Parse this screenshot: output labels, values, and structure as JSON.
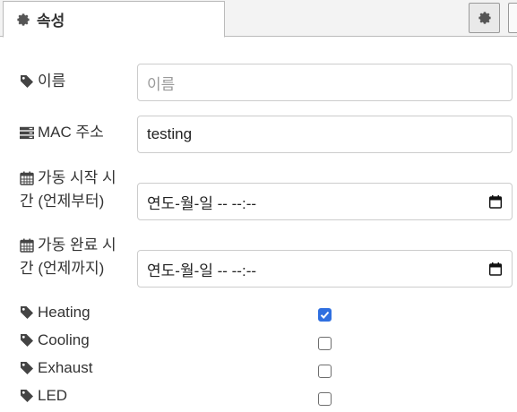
{
  "tab": {
    "label": "속성",
    "icon": "gear-icon"
  },
  "fields": {
    "name": {
      "label": "이름",
      "placeholder": "이름",
      "value": ""
    },
    "mac": {
      "label": "MAC 주소",
      "value": "testing"
    },
    "start": {
      "label_line1": "가동 시작 시",
      "label_line2": "간 (언제부터)",
      "value": "연도-월-일 -- --:--"
    },
    "end": {
      "label_line1": "가동 완료 시",
      "label_line2": "간 (언제까지)",
      "value": "연도-월-일 -- --:--"
    }
  },
  "checks": [
    {
      "label": "Heating",
      "checked": true
    },
    {
      "label": "Cooling",
      "checked": false
    },
    {
      "label": "Exhaust",
      "checked": false
    },
    {
      "label": "LED",
      "checked": false
    }
  ],
  "colors": {
    "checkbox_checked": "#2f6fe0",
    "border": "#cccccc"
  }
}
